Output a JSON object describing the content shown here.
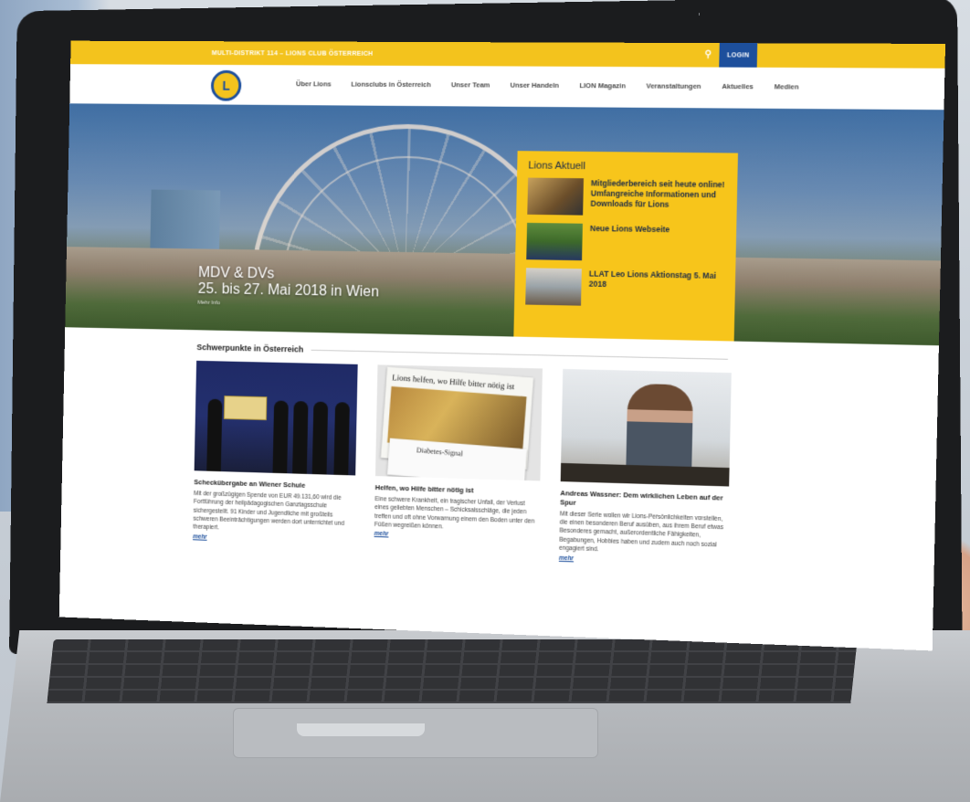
{
  "site": {
    "topbar_text": "MULTI-DISTRIKT 114 – LIONS CLUB ÖSTERREICH",
    "login_label": "LOGIN",
    "logo_letter": "L"
  },
  "nav": {
    "items": [
      "Über Lions",
      "Lionsclubs in Österreich",
      "Unser Team",
      "Unser Handeln",
      "LION Magazin",
      "Veranstaltungen",
      "Aktuelles",
      "Medien"
    ]
  },
  "hero": {
    "line1": "MDV & DVs",
    "line2": "25. bis 27. Mai 2018 in Wien",
    "more": "Mehr Info"
  },
  "news": {
    "heading": "Lions Aktuell",
    "items": [
      {
        "title": "Mitgliederbereich seit heute online! Umfangreiche Informationen und Downloads für Lions"
      },
      {
        "title": "Neue Lions Webseite"
      },
      {
        "title": "LLAT Leo Lions Aktionstag 5. Mai 2018"
      }
    ]
  },
  "section": {
    "heading": "Schwerpunkte in Österreich"
  },
  "cards": [
    {
      "title": "Schecküb­ergabe an Wiener Schule",
      "text": "Mit der großzügigen Spende von EUR 49.131,60 wird die Fortführung der heilpädagogischen Ganztagsschule sichergestellt. 91 Kinder und Jugendliche mit großteils schweren Beeinträchtigungen werden dort unterrichtet und therapiert.",
      "more": "mehr",
      "paper_head": ""
    },
    {
      "title": "Helfen, wo Hilfe bitter nötig ist",
      "text": "Eine schwere Krankheit, ein tragischer Unfall, der Verlust eines geliebten Menschen – Schicksalsschläge, die jeden treffen und oft ohne Vorwarnung einem den Boden unter den Füßen wegreißen können.",
      "more": "mehr",
      "paper_head": "Lions helfen, wo Hilfe bitter nötig ist",
      "paper2": "Diabetes-Signal"
    },
    {
      "title": "Andreas Wassner: Dem wirklichen Leben auf der Spur",
      "text": "Mit dieser Serie wollen wir Lions-Persönlichkeiten vorstellen, die einen besonderen Beruf ausüben, aus ihrem Beruf etwas Besonderes gemacht, außerordentliche Fähigkeiten, Begabungen, Hobbies haben und zudem auch noch sozial engagiert sind.",
      "more": "mehr"
    }
  ],
  "colors": {
    "brand_yellow": "#f3c31d",
    "brand_blue": "#1d4f9c"
  }
}
